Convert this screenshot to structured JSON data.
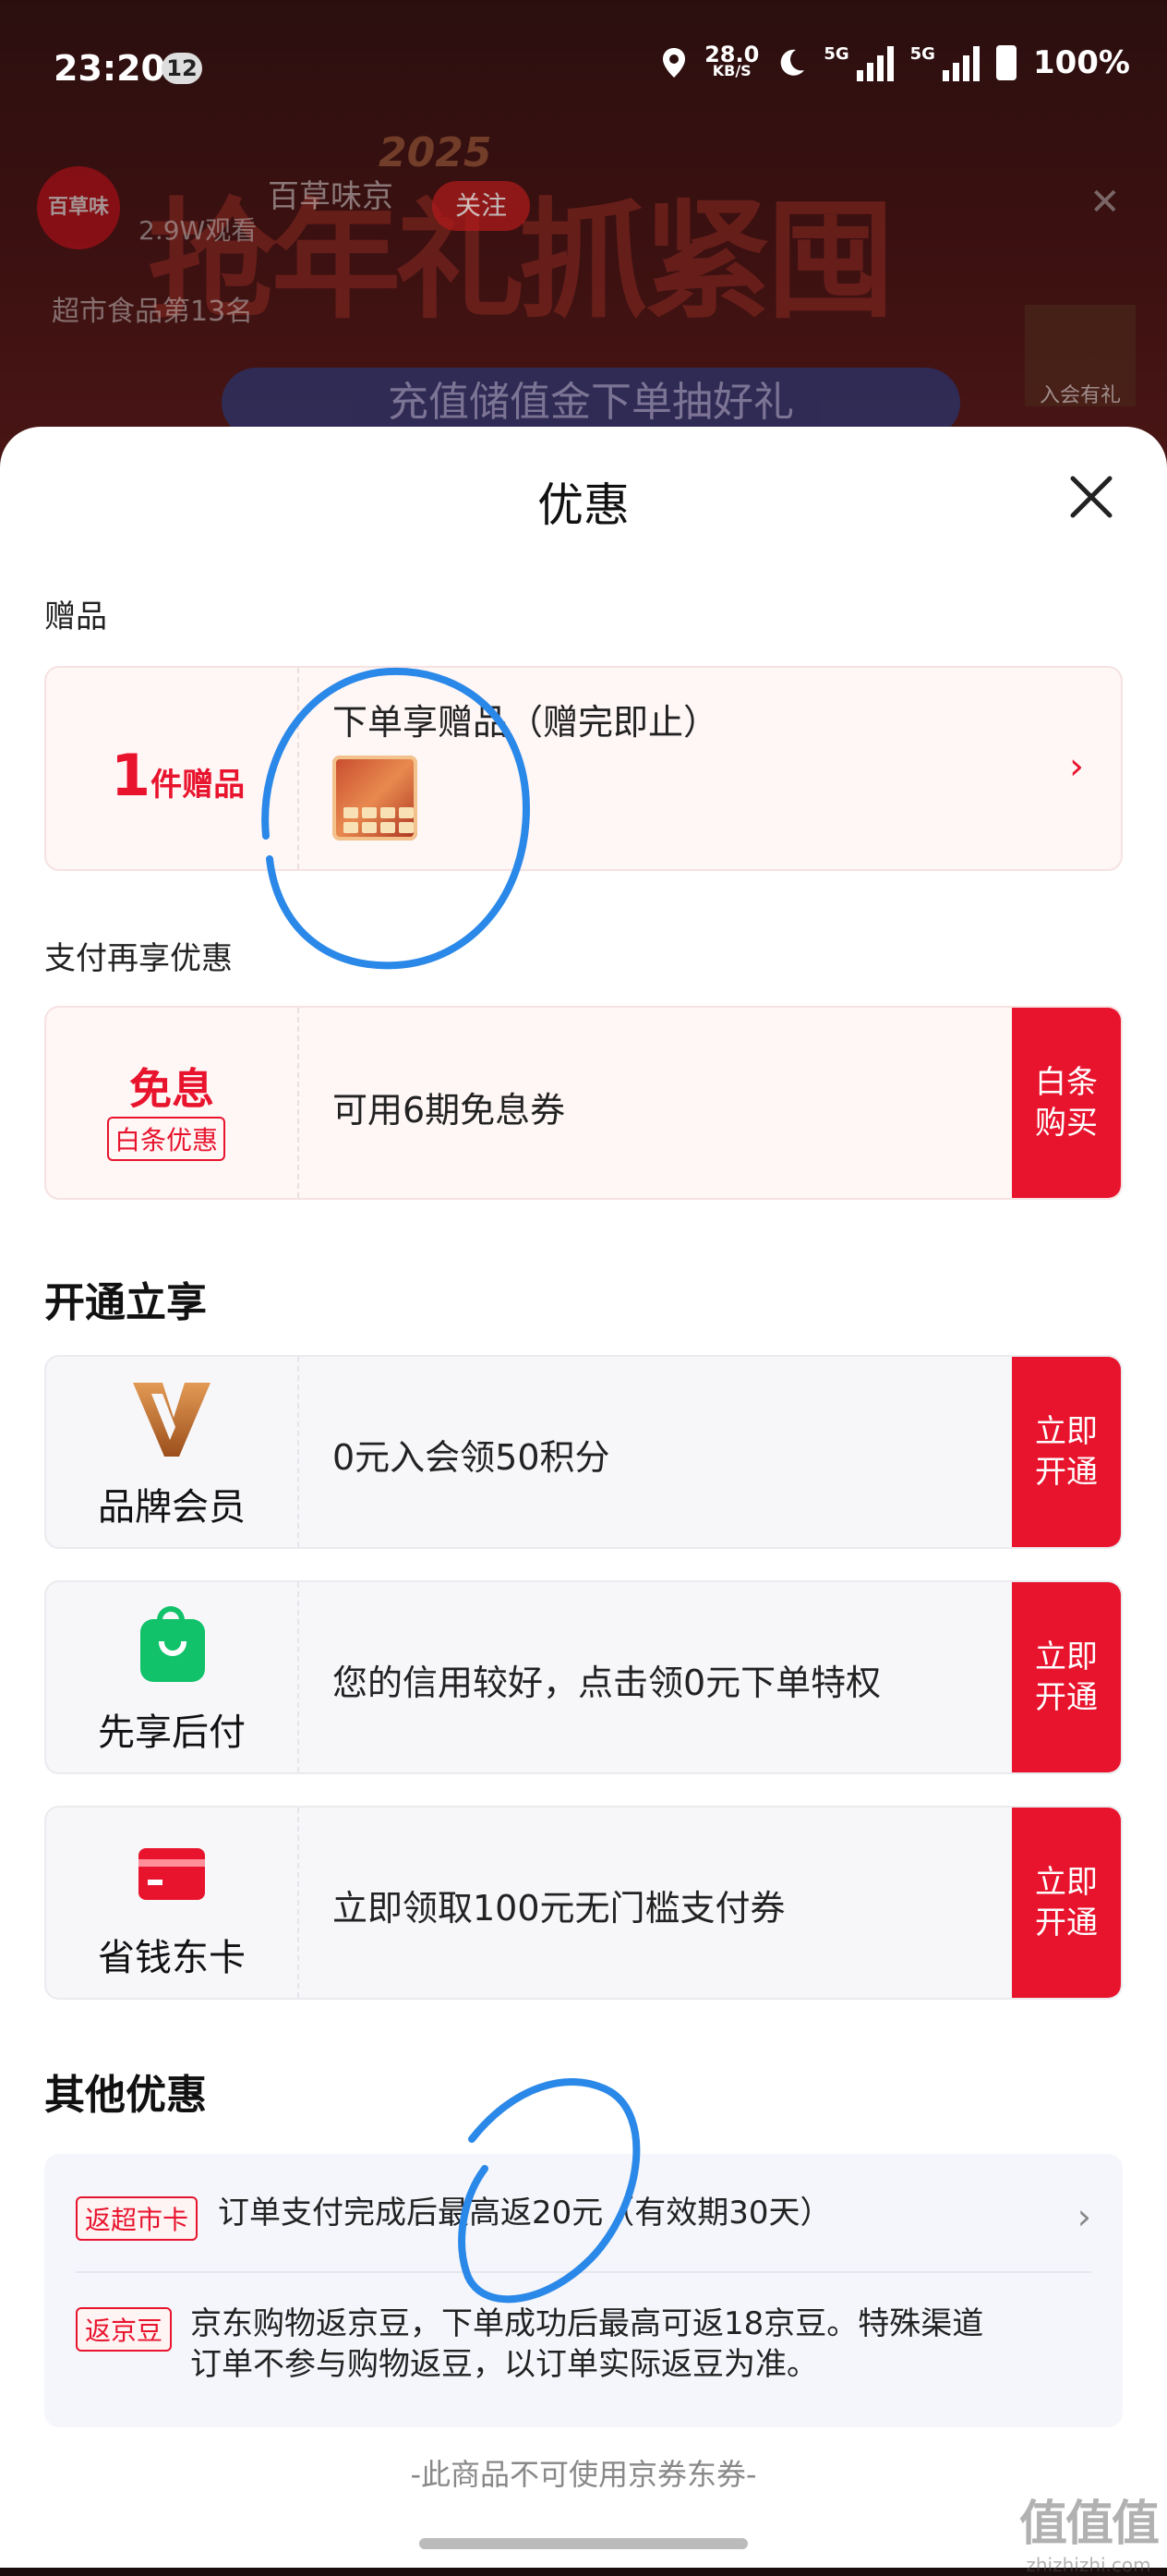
{
  "status_bar": {
    "time": "23:20",
    "notification_count": "12",
    "speed_value": "28.0",
    "speed_unit": "KB/S",
    "network1": "5G",
    "network2": "5G",
    "battery": "100%"
  },
  "background": {
    "brand_logo_text": "百草味",
    "viewers": "2.9W观看",
    "shop_name": "百草味京",
    "follow": "关注",
    "year": "2025",
    "banner": "抢年礼抓紧囤",
    "rank": "超市食品第13名",
    "charge_banner": "充值储值金下单抽好礼",
    "member_badge": "入会有礼"
  },
  "sheet": {
    "title": "优惠",
    "gift_section": {
      "label": "赠品",
      "count": "1",
      "unit": "件赠品",
      "description": "下单享赠品（赠完即止）"
    },
    "pay_section": {
      "label": "支付再享优惠",
      "left_title": "免息",
      "left_tag": "白条优惠",
      "description": "可用6期免息券",
      "cta_line1": "白条",
      "cta_line2": "购买"
    },
    "open_section": {
      "heading": "开通立享",
      "items": [
        {
          "name": "品牌会员",
          "description": "0元入会领50积分",
          "cta_line1": "立即",
          "cta_line2": "开通"
        },
        {
          "name": "先享后付",
          "description": "您的信用较好，点击领0元下单特权",
          "cta_line1": "立即",
          "cta_line2": "开通"
        },
        {
          "name": "省钱东卡",
          "description": "立即领取100元无门槛支付券",
          "cta_line1": "立即",
          "cta_line2": "开通"
        }
      ]
    },
    "other_section": {
      "heading": "其他优惠",
      "rows": [
        {
          "tag": "返超市卡",
          "text": "订单支付完成后最高返20元（有效期30天）"
        },
        {
          "tag": "返京豆",
          "text_line1": "京东购物返京豆，下单成功后最高可返18京豆。特殊渠道",
          "text_line2": "订单不参与购物返豆，以订单实际返豆为准。"
        }
      ]
    },
    "footnote": "-此商品不可使用京券东券-"
  },
  "watermark": {
    "big": "值值值",
    "small": "zhizhizhi.com"
  },
  "colors": {
    "accent": "#e8142d",
    "gift_bg": "#fff6f6",
    "perk_bg": "#f7f7fa",
    "green": "#11c26a",
    "annotation": "#2a88e8"
  },
  "icons": [
    "close-icon",
    "chevron-right-icon",
    "brand-member-v-icon",
    "shopping-bag-icon",
    "bank-card-icon",
    "location-icon",
    "moon-icon",
    "battery-icon"
  ]
}
